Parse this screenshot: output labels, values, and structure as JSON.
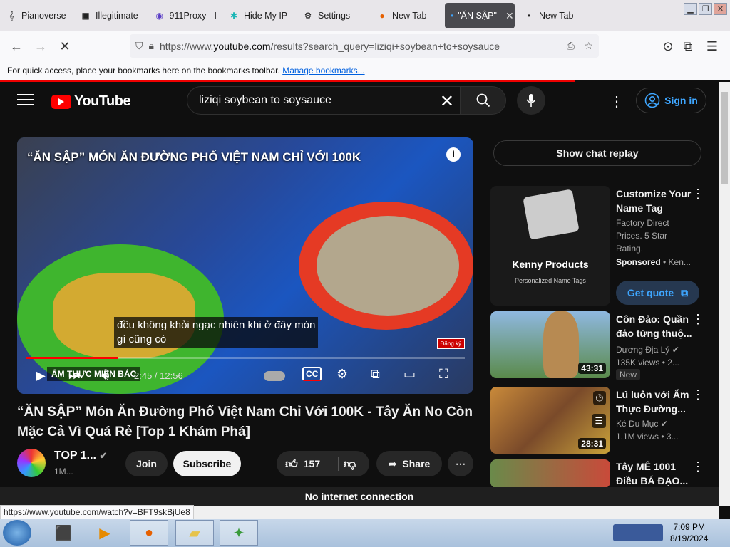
{
  "browser": {
    "tabs": [
      {
        "label": "Pianoverse",
        "icon": "piano-icon"
      },
      {
        "label": "Illegitimate",
        "icon": "page-icon"
      },
      {
        "label": "911Proxy - I",
        "icon": "proxy-icon"
      },
      {
        "label": "Hide My IP",
        "icon": "hidemyip-icon"
      },
      {
        "label": "Settings",
        "icon": "gear-icon"
      },
      {
        "label": "New Tab",
        "icon": "firefox-icon"
      },
      {
        "label": "\"ĂN SẬP\"",
        "icon": "youtube-icon",
        "active": true
      },
      {
        "label": "New Tab",
        "icon": "dot-icon"
      }
    ],
    "url_prefix": "https://www.",
    "url_domain": "youtube.com",
    "url_rest": "/results?search_query=liziqi+soybean+to+soysauce",
    "bookmarks_text": "For quick access, place your bookmarks here on the bookmarks toolbar.",
    "bookmarks_link": "Manage bookmarks...",
    "status_url": "https://www.youtube.com/watch?v=BFT9skBjUe8"
  },
  "youtube": {
    "logo_text": "YouTube",
    "search_value": "liziqi soybean to soysauce",
    "sign_in": "Sign in",
    "player": {
      "overlay_title": "“ĂN SẬP” MÓN ĂN ĐƯỜNG PHỐ VIỆT NAM CHỈ VỚI 100K",
      "caption_line1": "đều không khỏi ngạc nhiên khi ở đây món",
      "caption_line2": "gì cũng có",
      "time": "2:45 / 12:56",
      "progress_fraction": 0.21,
      "watermark": "ẨM THỰC MIỀN BẮC",
      "sub_badge": "Đăng ký"
    },
    "video_title": "“ĂN SẬP” Món Ăn Đường Phố Việt Nam Chỉ Với 100K - Tây Ăn No Còn Mặc Cả Vì Quá Rẻ [Top 1 Khám Phá]",
    "channel_name": "TOP 1...",
    "channel_subs": "1M...",
    "join": "Join",
    "subscribe": "Subscribe",
    "likes": "157",
    "share": "Share",
    "chat_replay": "Show chat replay",
    "sidebar": [
      {
        "title_l1": "Customize Your",
        "title_l2": "Name Tag",
        "meta_l1": "Factory Direct",
        "meta_l2": "Prices. 5 Star",
        "meta_l3": "Rating.",
        "sponsored": "Sponsored",
        "sponsor_name": "• Ken...",
        "thumb_title": "Kenny Products",
        "thumb_sub": "Personalized Name Tags",
        "cta": "Get quote"
      },
      {
        "title_l1": "Côn Đảo: Quần",
        "title_l2": "đảo từng thuộ...",
        "channel": "Dương Địa Lý",
        "views": "135K views",
        "age": "• 2...",
        "duration": "43:31",
        "badge": "New"
      },
      {
        "title_l1": "Lú luôn với Ẩm",
        "title_l2": "Thực Đường...",
        "channel": "Ké Du Mục",
        "views": "1.1M views",
        "age": "• 3...",
        "duration": "28:31"
      },
      {
        "title_l1": "Tây MÊ 1001",
        "title_l2": "Điều BÁ ĐẠO..."
      }
    ],
    "offline": "No internet connection"
  },
  "taskbar": {
    "time": "7:09 PM",
    "date": "8/19/2024"
  }
}
